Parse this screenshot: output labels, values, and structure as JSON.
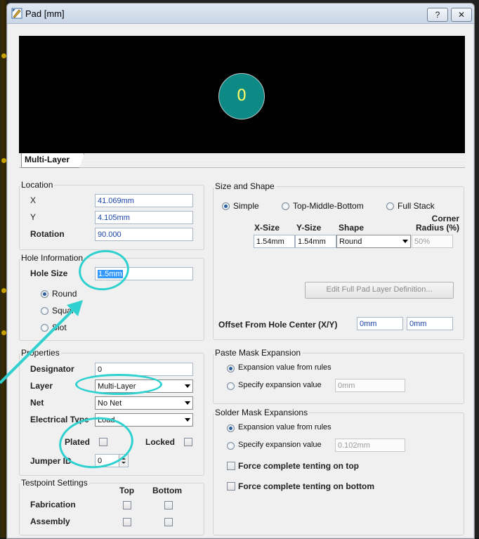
{
  "window": {
    "title": "Pad [mm]",
    "help_label": "?",
    "close_label": "✕"
  },
  "preview": {
    "pad_label": "0",
    "pad_color": "#0e8a86",
    "tab_label": "Multi-Layer"
  },
  "location": {
    "legend": "Location",
    "x_label": "X",
    "x_value": "41.069mm",
    "y_label": "Y",
    "y_value": "4.105mm",
    "rotation_label": "Rotation",
    "rotation_value": "90.000"
  },
  "hole": {
    "legend": "Hole Information",
    "size_label": "Hole Size",
    "size_value": "1.5mm",
    "options": [
      "Round",
      "Square",
      "Slot"
    ],
    "selected": "Round"
  },
  "properties": {
    "legend": "Properties",
    "designator_label": "Designator",
    "designator_value": "0",
    "layer_label": "Layer",
    "layer_value": "Multi-Layer",
    "net_label": "Net",
    "net_value": "No Net",
    "etype_label": "Electrical Type",
    "etype_value": "Load",
    "plated_label": "Plated",
    "locked_label": "Locked",
    "jumper_label": "Jumper ID",
    "jumper_value": "0"
  },
  "testpoint": {
    "legend": "Testpoint Settings",
    "col_top": "Top",
    "col_bottom": "Bottom",
    "row_fab": "Fabrication",
    "row_asm": "Assembly"
  },
  "size_shape": {
    "legend": "Size and Shape",
    "opt_simple": "Simple",
    "opt_tmb": "Top-Middle-Bottom",
    "opt_full": "Full Stack",
    "col_xsize": "X-Size",
    "col_ysize": "Y-Size",
    "col_shape": "Shape",
    "col_corner": "Corner\nRadius (%)",
    "xsize": "1.54mm",
    "ysize": "1.54mm",
    "shape": "Round",
    "corner": "50%",
    "edit_button": "Edit Full Pad Layer Definition...",
    "offset_label": "Offset From Hole Center (X/Y)",
    "offset_x": "0mm",
    "offset_y": "0mm"
  },
  "paste": {
    "legend": "Paste Mask Expansion",
    "opt_rules": "Expansion value from rules",
    "opt_specify": "Specify expansion value",
    "value": "0mm"
  },
  "solder": {
    "legend": "Solder Mask Expansions",
    "opt_rules": "Expansion value from rules",
    "opt_specify": "Specify expansion value",
    "value": "0.102mm",
    "tent_top": "Force complete tenting on top",
    "tent_bottom": "Force complete tenting on bottom"
  },
  "colors": {
    "annotation": "#2ed1cf",
    "link_text": "#1a44a8"
  }
}
